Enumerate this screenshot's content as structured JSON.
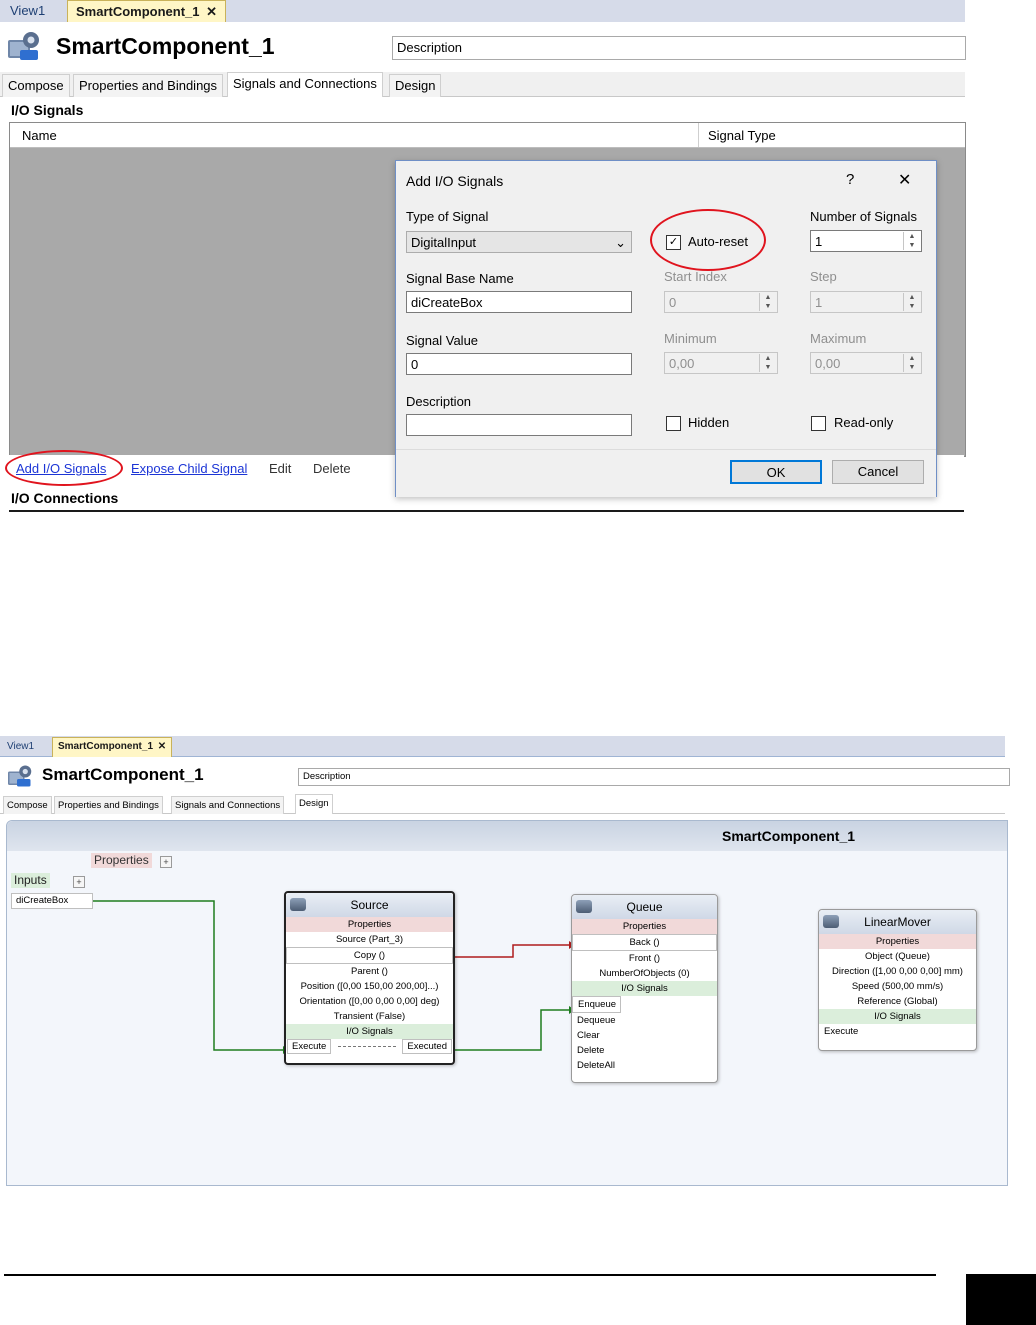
{
  "top": {
    "doc_tabs": [
      "View1",
      "SmartComponent_1"
    ],
    "close_glyph": "✕",
    "component_title": "SmartComponent_1",
    "description_placeholder": "Description",
    "editor_tabs": [
      "Compose",
      "Properties and Bindings",
      "Signals and Connections",
      "Design"
    ],
    "active_editor_tab": "Signals and Connections",
    "io_signals_label": "I/O Signals",
    "columns": [
      "Name",
      "Signal Type"
    ],
    "actions": [
      "Add I/O Signals",
      "Expose Child Signal",
      "Edit",
      "Delete"
    ],
    "io_connections_label": "I/O Connections",
    "dialog": {
      "title": "Add I/O Signals",
      "help_glyph": "?",
      "close_glyph": "✕",
      "type_of_signal_label": "Type of Signal",
      "type_of_signal_value": "DigitalInput",
      "auto_reset_label": "Auto-reset",
      "auto_reset_checked": true,
      "number_of_signals_label": "Number of Signals",
      "number_of_signals_value": "1",
      "signal_base_name_label": "Signal Base Name",
      "signal_base_name_value": "diCreateBox",
      "start_index_label": "Start Index",
      "start_index_value": "0",
      "step_label": "Step",
      "step_value": "1",
      "signal_value_label": "Signal Value",
      "signal_value_value": "0",
      "minimum_label": "Minimum",
      "minimum_value": "0,00",
      "maximum_label": "Maximum",
      "maximum_value": "0,00",
      "description_label": "Description",
      "description_value": "",
      "hidden_label": "Hidden",
      "read_only_label": "Read-only",
      "ok_label": "OK",
      "cancel_label": "Cancel"
    },
    "annotation_color": "#e0141e"
  },
  "bottom": {
    "doc_tabs": [
      "View1",
      "SmartComponent_1"
    ],
    "close_glyph": "✕",
    "component_title": "SmartComponent_1",
    "description_placeholder": "Description",
    "editor_tabs": [
      "Compose",
      "Properties and Bindings",
      "Signals and Connections",
      "Design"
    ],
    "active_editor_tab": "Design",
    "canvas_title": "SmartComponent_1",
    "properties_tag": "Properties",
    "inputs_tag": "Inputs",
    "plus": "+",
    "input_signal": "diCreateBox",
    "source": {
      "title": "Source",
      "properties_label": "Properties",
      "rows": [
        "Source (Part_3)",
        "Copy ()",
        "Parent ()",
        "Position ([0,00 150,00 200,00]...)",
        "Orientation ([0,00 0,00 0,00] deg)",
        "Transient (False)"
      ],
      "io_label": "I/O Signals",
      "in_port": "Execute",
      "out_port": "Executed"
    },
    "queue": {
      "title": "Queue",
      "properties_label": "Properties",
      "rows": [
        "Back ()",
        "Front ()",
        "NumberOfObjects (0)"
      ],
      "io_label": "I/O Signals",
      "ports": [
        "Enqueue",
        "Dequeue",
        "Clear",
        "Delete",
        "DeleteAll"
      ]
    },
    "linearmover": {
      "title": "LinearMover",
      "properties_label": "Properties",
      "rows": [
        "Object (Queue)",
        "Direction ([1,00 0,00 0,00] mm)",
        "Speed (500,00 mm/s)",
        "Reference (Global)"
      ],
      "io_label": "I/O Signals",
      "ports": [
        "Execute"
      ]
    },
    "signal_link_color": "#1e7d1e",
    "property_link_color": "#b01c1c"
  }
}
